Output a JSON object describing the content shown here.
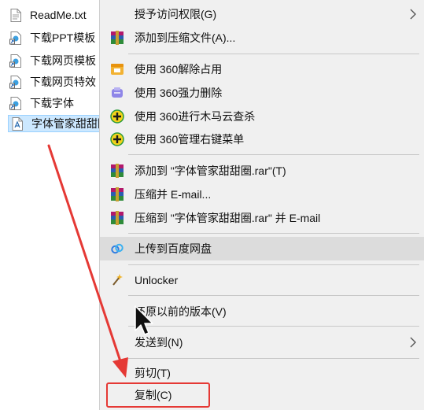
{
  "file_list": {
    "items": [
      {
        "name": "ReadMe.txt",
        "icon": "text-file-icon",
        "selected": false
      },
      {
        "name": "下载PPT模板",
        "icon": "shortcut-icon",
        "selected": false
      },
      {
        "name": "下载网页模板",
        "icon": "shortcut-icon",
        "selected": false
      },
      {
        "name": "下载网页特效",
        "icon": "shortcut-icon",
        "selected": false
      },
      {
        "name": "下载字体",
        "icon": "shortcut-icon",
        "selected": false
      },
      {
        "name": "字体管家甜甜圈",
        "icon": "font-file-icon",
        "selected": true
      }
    ]
  },
  "context_menu": {
    "items": [
      {
        "label": "授予访问权限(G)",
        "icon": "",
        "submenu": true
      },
      {
        "label": "添加到压缩文件(A)...",
        "icon": "winrar-icon",
        "submenu": false
      },
      {
        "label": "使用 360解除占用",
        "icon": "360-unlock-icon",
        "submenu": false
      },
      {
        "label": "使用 360强力删除",
        "icon": "360-delete-icon",
        "submenu": false
      },
      {
        "label": "使用 360进行木马云查杀",
        "icon": "360-scan-icon",
        "submenu": false
      },
      {
        "label": "使用 360管理右键菜单",
        "icon": "360-manage-icon",
        "submenu": false
      },
      {
        "label": "添加到 \"字体管家甜甜圈.rar\"(T)",
        "icon": "winrar-icon",
        "submenu": false
      },
      {
        "label": "压缩并 E-mail...",
        "icon": "winrar-icon",
        "submenu": false
      },
      {
        "label": "压缩到 \"字体管家甜甜圈.rar\" 并 E-mail",
        "icon": "winrar-icon",
        "submenu": false
      },
      {
        "label": "上传到百度网盘",
        "icon": "baidu-netdisk-icon",
        "submenu": false,
        "highlighted": true
      },
      {
        "label": "Unlocker",
        "icon": "unlocker-wand-icon",
        "submenu": false
      },
      {
        "label": "还原以前的版本(V)",
        "icon": "",
        "submenu": false
      },
      {
        "label": "发送到(N)",
        "icon": "",
        "submenu": true
      },
      {
        "label": "剪切(T)",
        "icon": "",
        "submenu": false
      },
      {
        "label": "复制(C)",
        "icon": "",
        "submenu": false,
        "annotated": true
      }
    ]
  },
  "colors": {
    "menu_background": "#f0f0f0",
    "hover_background": "#dcdcdc",
    "annotation_red": "#e53935",
    "selection_background": "#cce8ff"
  }
}
